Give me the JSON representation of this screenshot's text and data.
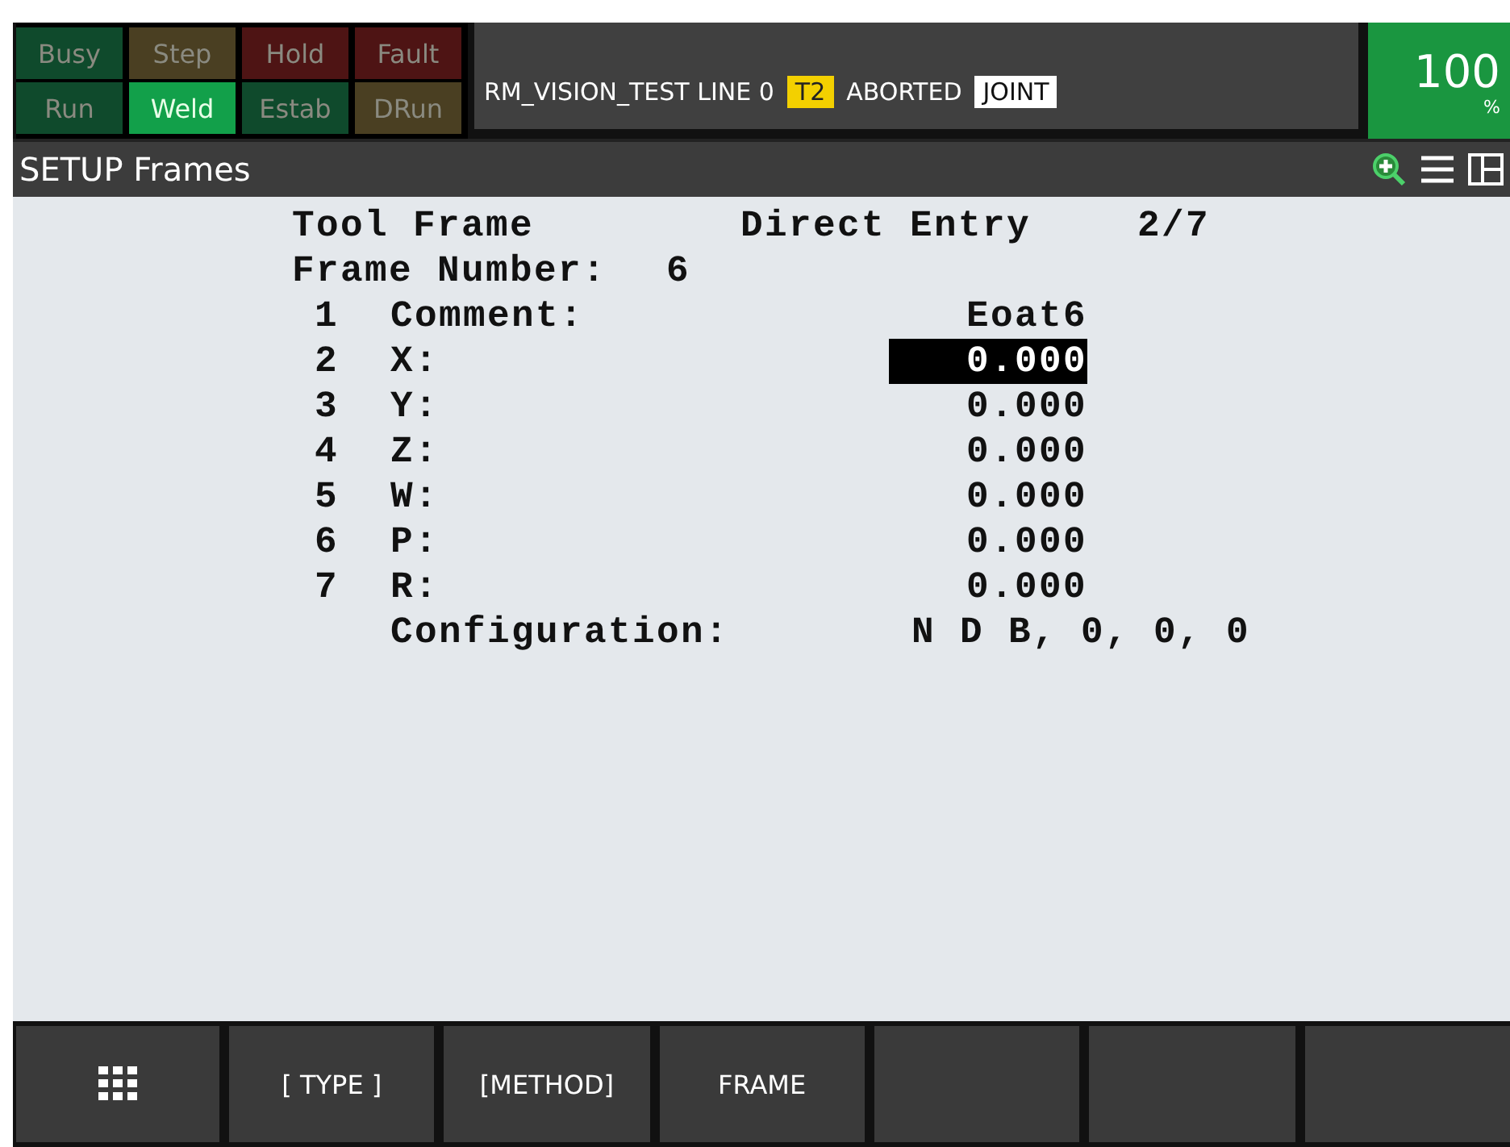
{
  "status_lamps": [
    {
      "label": "Busy",
      "on": false,
      "color": "#0f4a2c"
    },
    {
      "label": "Step",
      "on": false,
      "color": "#4a3f22"
    },
    {
      "label": "Hold",
      "on": false,
      "color": "#4e1414"
    },
    {
      "label": "Fault",
      "on": false,
      "color": "#4e1414"
    },
    {
      "label": "Run",
      "on": false,
      "color": "#0f4a2c"
    },
    {
      "label": "Weld",
      "on": true,
      "color": "#12a04a"
    },
    {
      "label": "Estab",
      "on": false,
      "color": "#0f4a2c"
    },
    {
      "label": "DRun",
      "on": false,
      "color": "#4a3f22"
    }
  ],
  "status_message": {
    "program": "RM_VISION_TEST LINE 0",
    "mode": "T2",
    "state": "ABORTED",
    "coord": "JOINT"
  },
  "override": {
    "value": "100",
    "unit": "%"
  },
  "screen_title": "SETUP Frames",
  "header": {
    "frame_type": "Tool Frame",
    "method": "Direct Entry",
    "page": "2/7",
    "number_label": "Frame Number:",
    "number": "6"
  },
  "items": [
    {
      "kind": "field",
      "number": "1",
      "label": "Comment:",
      "value": "Eoat6",
      "selected": false
    },
    {
      "kind": "field",
      "number": "2",
      "label": "X:",
      "value": "0.000",
      "selected": true
    },
    {
      "kind": "field",
      "number": "3",
      "label": "Y:",
      "value": "0.000",
      "selected": false
    },
    {
      "kind": "field",
      "number": "4",
      "label": "Z:",
      "value": "0.000",
      "selected": false
    },
    {
      "kind": "field",
      "number": "5",
      "label": "W:",
      "value": "0.000",
      "selected": false
    },
    {
      "kind": "field",
      "number": "6",
      "label": "P:",
      "value": "0.000",
      "selected": false
    },
    {
      "kind": "field",
      "number": "7",
      "label": "R:",
      "value": "0.000",
      "selected": false
    },
    {
      "kind": "info",
      "label": "Configuration:",
      "value": "N D B, 0, 0, 0"
    }
  ],
  "softkeys": [
    {
      "kind": "label",
      "label": "[ TYPE ]"
    },
    {
      "kind": "label",
      "label": "[METHOD]"
    },
    {
      "kind": "label",
      "label": "FRAME"
    },
    {
      "kind": "blank"
    },
    {
      "kind": "blank"
    },
    {
      "kind": "blank"
    }
  ]
}
